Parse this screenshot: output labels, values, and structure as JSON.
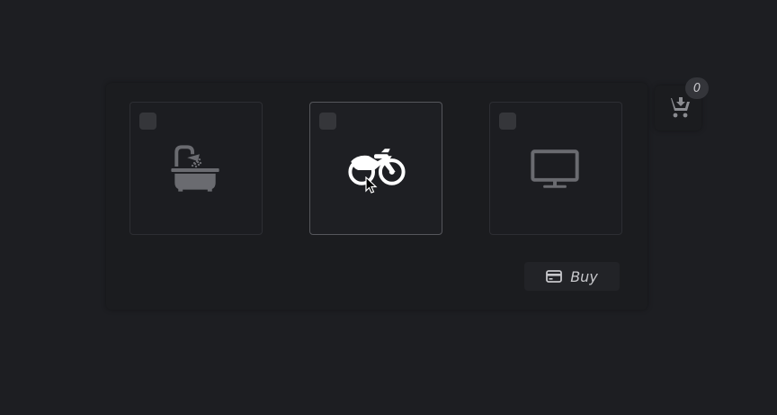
{
  "products": [
    {
      "icon": "bathtub-shower-icon",
      "selected": false
    },
    {
      "icon": "motorcycle-icon",
      "selected": false,
      "hovered": true
    },
    {
      "icon": "monitor-icon",
      "selected": false
    }
  ],
  "buy_button": {
    "label": "Buy",
    "icon": "credit-card-icon"
  },
  "cart": {
    "icon": "cart-arrow-down-icon",
    "count": "0"
  },
  "colors": {
    "background": "#1d1e22",
    "icon_inactive": "#6a6b70",
    "icon_active": "#ffffff",
    "text": "#c7c7cb"
  }
}
